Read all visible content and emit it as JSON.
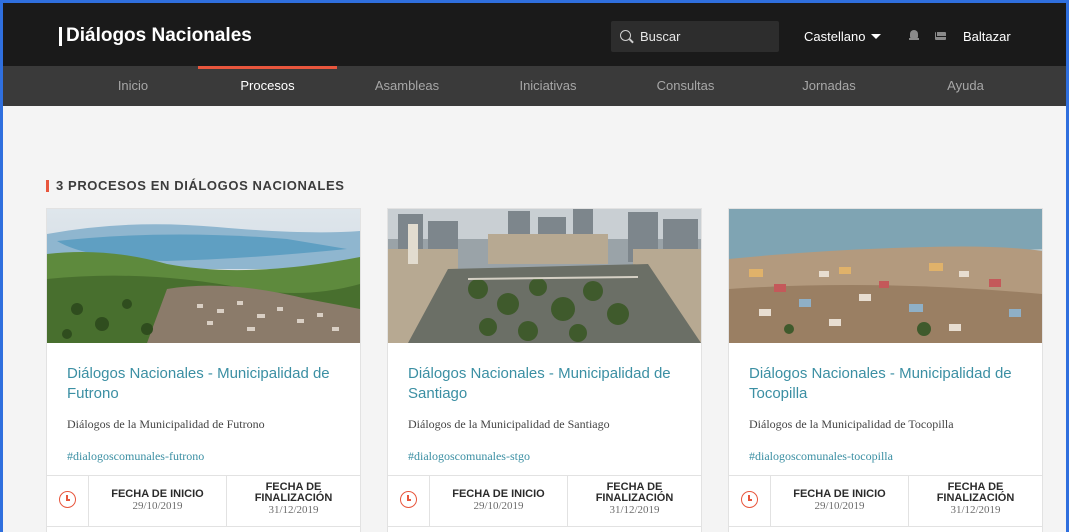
{
  "header": {
    "brand": "Diálogos Nacionales",
    "search_placeholder": "Buscar",
    "language": "Castellano",
    "user": "Baltazar"
  },
  "nav": {
    "items": [
      {
        "label": "Inicio",
        "active": false
      },
      {
        "label": "Procesos",
        "active": true
      },
      {
        "label": "Asambleas",
        "active": false
      },
      {
        "label": "Iniciativas",
        "active": false
      },
      {
        "label": "Consultas",
        "active": false
      },
      {
        "label": "Jornadas",
        "active": false
      },
      {
        "label": "Ayuda",
        "active": false
      }
    ]
  },
  "section": {
    "title": "3 PROCESOS EN DIÁLOGOS NACIONALES"
  },
  "cards": [
    {
      "title": "Diálogos Nacionales - Municipalidad de Futrono",
      "description": "Diálogos de la Municipalidad de Futrono",
      "hashtag": "#dialogoscomunales-futrono",
      "start_label": "FECHA DE INICIO",
      "start_date": "29/10/2019",
      "end_label_1": "FECHA DE",
      "end_label_2": "FINALIZACIÓN",
      "end_date": "31/12/2019",
      "image": "lake-town-aerial"
    },
    {
      "title": "Diálogos Nacionales - Municipalidad de Santiago",
      "description": "Diálogos de la Municipalidad de Santiago",
      "hashtag": "#dialogoscomunales-stgo",
      "start_label": "FECHA DE INICIO",
      "start_date": "29/10/2019",
      "end_label_1": "FECHA DE",
      "end_label_2": "FINALIZACIÓN",
      "end_date": "31/12/2019",
      "image": "city-plaza-aerial"
    },
    {
      "title": "Diálogos Nacionales - Municipalidad de Tocopilla",
      "description": "Diálogos de la Municipalidad de Tocopilla",
      "hashtag": "#dialogoscomunales-tocopilla",
      "start_label": "FECHA DE INICIO",
      "start_date": "29/10/2019",
      "end_label_1": "FECHA DE",
      "end_label_2": "FINALIZACIÓN",
      "end_date": "31/12/2019",
      "image": "coastal-town-aerial"
    }
  ],
  "colors": {
    "accent": "#e8563d",
    "link": "#3b8fa3",
    "header_bg": "#1a1a1a",
    "nav_bg": "#3a3a3a"
  }
}
